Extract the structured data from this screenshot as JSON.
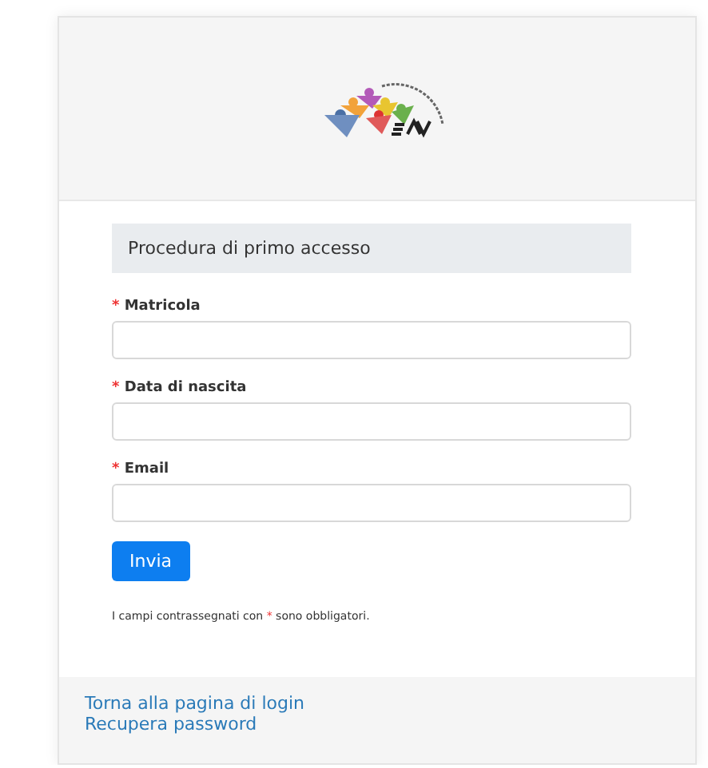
{
  "section_title": "Procedura di primo accesso",
  "fields": [
    {
      "mark": "*",
      "label": "Matricola"
    },
    {
      "mark": "*",
      "label": "Data di nascita"
    },
    {
      "mark": "*",
      "label": "Email"
    }
  ],
  "submit": "Invia",
  "note": {
    "before": "I campi contrassegnati con",
    "mark": "*",
    "after": "sono obbligatori."
  },
  "footer_links": [
    "Torna alla pagina di login",
    "Recupera password"
  ]
}
